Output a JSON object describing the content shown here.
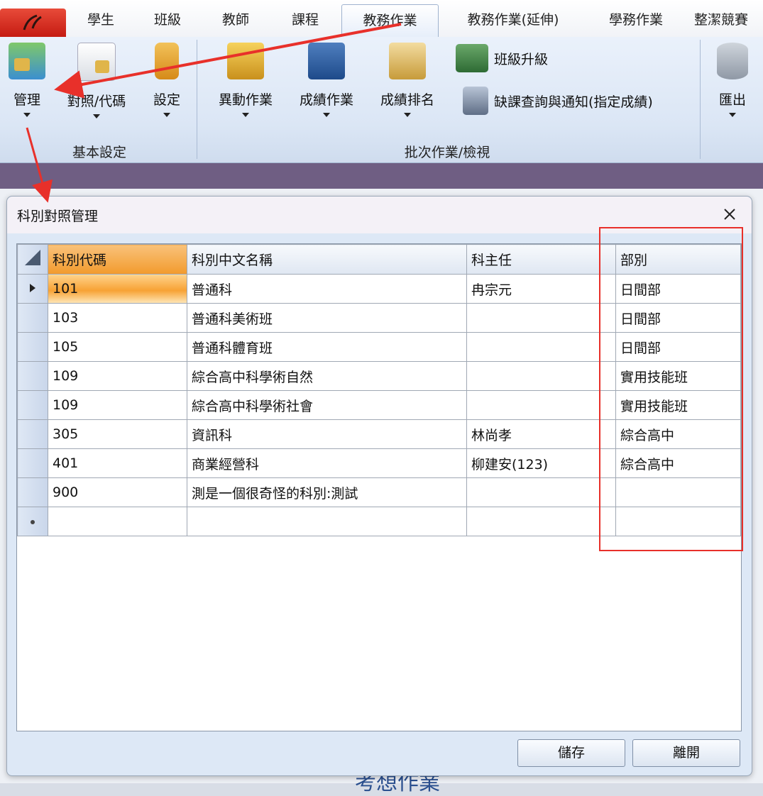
{
  "tabs": [
    "學生",
    "班級",
    "教師",
    "課程",
    "教務作業",
    "教務作業(延伸)",
    "學務作業",
    "整潔競賽"
  ],
  "active_tab": "教務作業",
  "ribbon": {
    "groups": [
      {
        "label": "基本設定",
        "buttons": [
          "管理",
          "對照/代碼",
          "設定"
        ]
      },
      {
        "label": "批次作業/檢視",
        "buttons": [
          "異動作業",
          "成績作業",
          "成績排名"
        ]
      }
    ],
    "small_buttons": [
      "班級升級",
      "缺課查詢與通知(指定成績)"
    ],
    "export_label": "匯出"
  },
  "dialog": {
    "title": "科別對照管理",
    "columns": [
      "科別代碼",
      "科別中文名稱",
      "科主任",
      "部別"
    ],
    "rows": [
      [
        "101",
        "普通科",
        "冉宗元",
        "日間部"
      ],
      [
        "103",
        "普通科美術班",
        "",
        "日間部"
      ],
      [
        "105",
        "普通科體育班",
        "",
        "日間部"
      ],
      [
        "109",
        "綜合高中科學術自然",
        "",
        "實用技能班"
      ],
      [
        "109",
        "綜合高中科學術社會",
        "",
        "實用技能班"
      ],
      [
        "305",
        "資訊科",
        "林尚孝",
        "綜合高中"
      ],
      [
        "401",
        "商業經營科",
        "柳建安(123)",
        "綜合高中"
      ],
      [
        "900",
        "測是一個很奇怪的科別:測試",
        "",
        ""
      ]
    ],
    "save_label": "儲存",
    "leave_label": "離開"
  },
  "background_text": "考想作業",
  "colors": {
    "annotation_red": "#e8302a",
    "selected_header": "#f29a2d",
    "purple_strip": "#6f5e83"
  }
}
